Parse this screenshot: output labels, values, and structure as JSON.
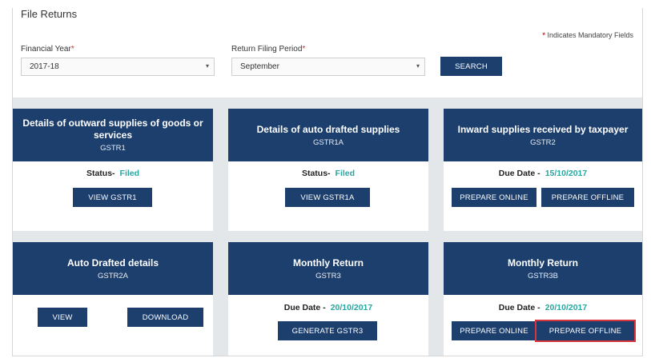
{
  "page": {
    "title": "File Returns",
    "mandatory_star": "*",
    "mandatory_note": "Indicates Mandatory Fields"
  },
  "filters": {
    "fy_label": "Financial Year",
    "fy_value": "2017-18",
    "period_label": "Return Filing Period",
    "period_value": "September",
    "required_mark": "*",
    "search_label": "SEARCH",
    "caret_icon": "▾"
  },
  "cards": {
    "gstr1": {
      "title": "Details of outward supplies of goods or services",
      "code": "GSTR1",
      "status_label": "Status-",
      "status_value": "Filed",
      "button": "VIEW GSTR1"
    },
    "gstr1a": {
      "title": "Details of auto drafted supplies",
      "code": "GSTR1A",
      "status_label": "Status-",
      "status_value": "Filed",
      "button": "VIEW GSTR1A"
    },
    "gstr2": {
      "title": "Inward supplies received by taxpayer",
      "code": "GSTR2",
      "due_label": "Due Date -",
      "due_value": "15/10/2017",
      "online_button": "PREPARE ONLINE",
      "offline_button": "PREPARE OFFLINE"
    },
    "gstr2a": {
      "title": "Auto Drafted details",
      "code": "GSTR2A",
      "view_button": "VIEW",
      "download_button": "DOWNLOAD"
    },
    "gstr3": {
      "title": "Monthly Return",
      "code": "GSTR3",
      "due_label": "Due Date -",
      "due_value": "20/10/2017",
      "button": "GENERATE GSTR3"
    },
    "gstr3b": {
      "title": "Monthly Return",
      "code": "GSTR3B",
      "due_label": "Due Date -",
      "due_value": "20/10/2017",
      "online_button": "PREPARE ONLINE",
      "offline_button": "PREPARE OFFLINE"
    }
  },
  "colors": {
    "header_navy": "#1c3f6d",
    "status_teal": "#2aa6a0",
    "required_red": "#c0392b",
    "highlight_red": "#d9343c"
  }
}
